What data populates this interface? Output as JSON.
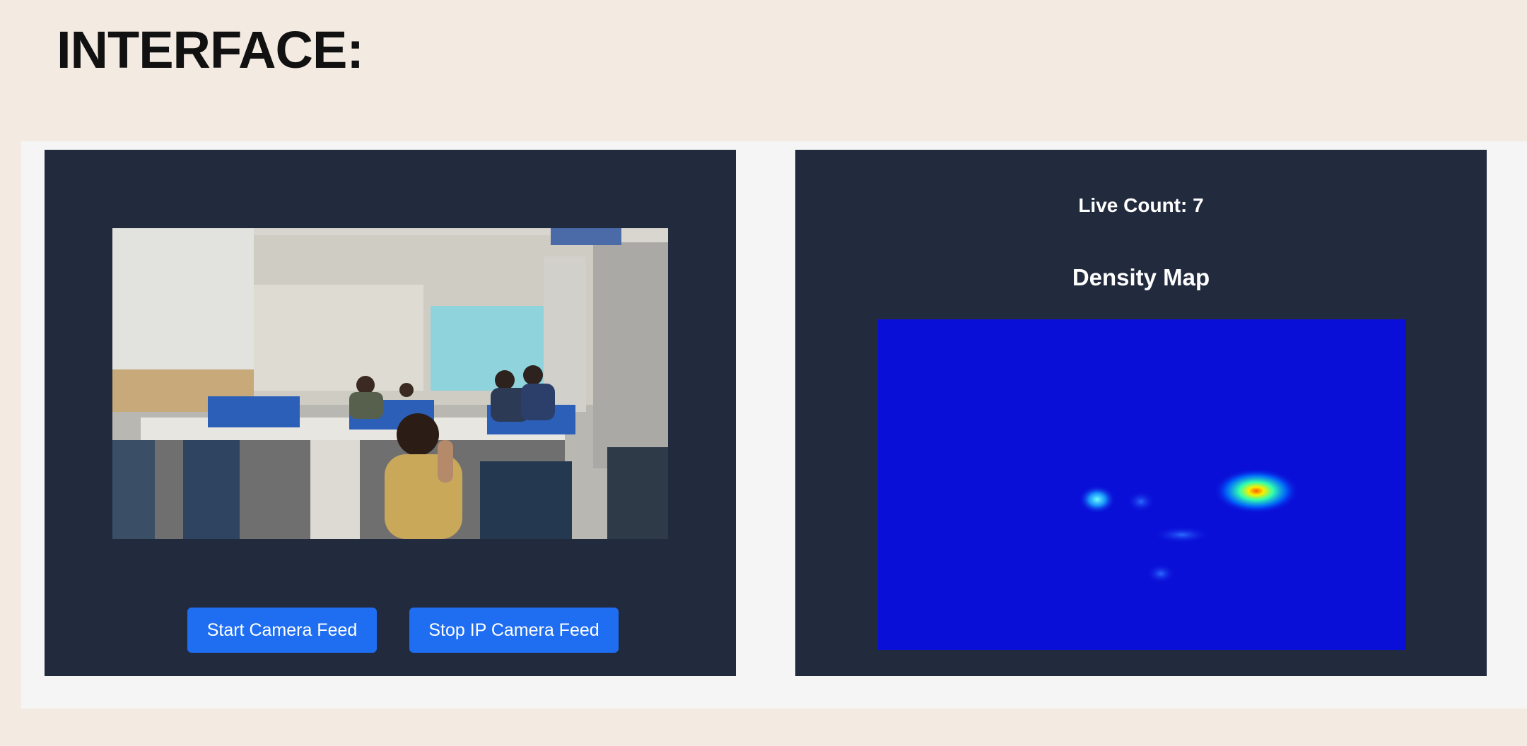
{
  "page": {
    "heading": "INTERFACE:"
  },
  "camera_panel": {
    "feed_image": "office-camera-feed",
    "buttons": {
      "start_label": "Start Camera Feed",
      "stop_label": "Stop IP Camera Feed"
    },
    "button_color": "#1f6ef2"
  },
  "density_panel": {
    "live_count_label": "Live Count: 7",
    "title": "Density Map",
    "map_image": "density-heatmap"
  },
  "colors": {
    "panel_background": "#222a3d",
    "page_background": "#f3ebe2",
    "heatmap_base": "#0a0fd8"
  }
}
